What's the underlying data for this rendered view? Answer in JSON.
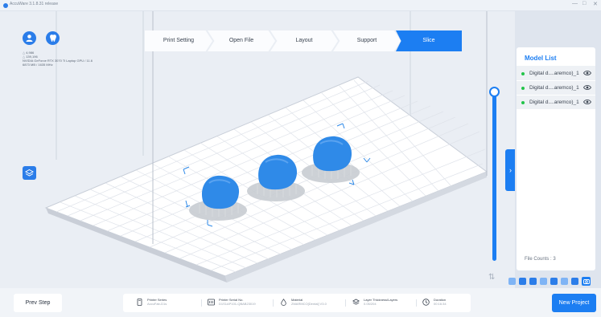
{
  "window": {
    "title": "AccuWare 3.1.8.31 release",
    "controls": [
      "—",
      "□",
      "✕"
    ]
  },
  "stepper": {
    "steps": [
      {
        "label": "Print Setting",
        "active": false
      },
      {
        "label": "Open File",
        "active": false
      },
      {
        "label": "Layout",
        "active": false
      },
      {
        "label": "Support",
        "active": false
      },
      {
        "label": "Slice",
        "active": true
      }
    ]
  },
  "stats": {
    "line1": "4,986",
    "line2": "139,196",
    "gpu": "NVIDIA GeForce RTX 3070 Ti Laptop GPU / 11.6",
    "memory": "6873 MB / 1635 MHz"
  },
  "model_panel": {
    "title": "Model List",
    "items": [
      {
        "label": "Digital d....aremco)_1"
      },
      {
        "label": "Digital d....aremco)_1"
      },
      {
        "label": "Digital d....aremco)_1"
      }
    ],
    "file_count": "File Counts : 3"
  },
  "bottom": {
    "prev_label": "Prev Step",
    "new_label": "New Project",
    "info": [
      {
        "label": "Printer Series",
        "value": "AccuFab-D1s"
      },
      {
        "label": "Printer Serial No.",
        "value": "D1S1AP101-QBAB23019"
      },
      {
        "label": "Material",
        "value": "ZMARMCO[Dental] V3.0"
      },
      {
        "label": "Layer Thickness/Layers",
        "value": "0.05/204"
      },
      {
        "label": "Duration",
        "value": "00:16:34"
      }
    ]
  },
  "colors": {
    "accent": "#1c7ef2",
    "model": "#2f8ae8",
    "support": "#c8ccd2",
    "status_ok": "#23c44a"
  }
}
